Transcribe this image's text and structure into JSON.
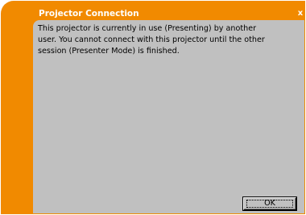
{
  "dialog": {
    "title": "Projector Connection",
    "close_glyph": "x",
    "message_lines": [
      "This projector is currently in use (Presenting) by another",
      "user. You cannot connect with this projector until the other",
      "session (Presenter Mode) is finished."
    ],
    "ok_label": "OK"
  },
  "colors": {
    "frame": "#f18a00",
    "content_background": "#c0c0c0",
    "title_text": "#ffffff"
  },
  "icons": {
    "close": "close-icon"
  }
}
